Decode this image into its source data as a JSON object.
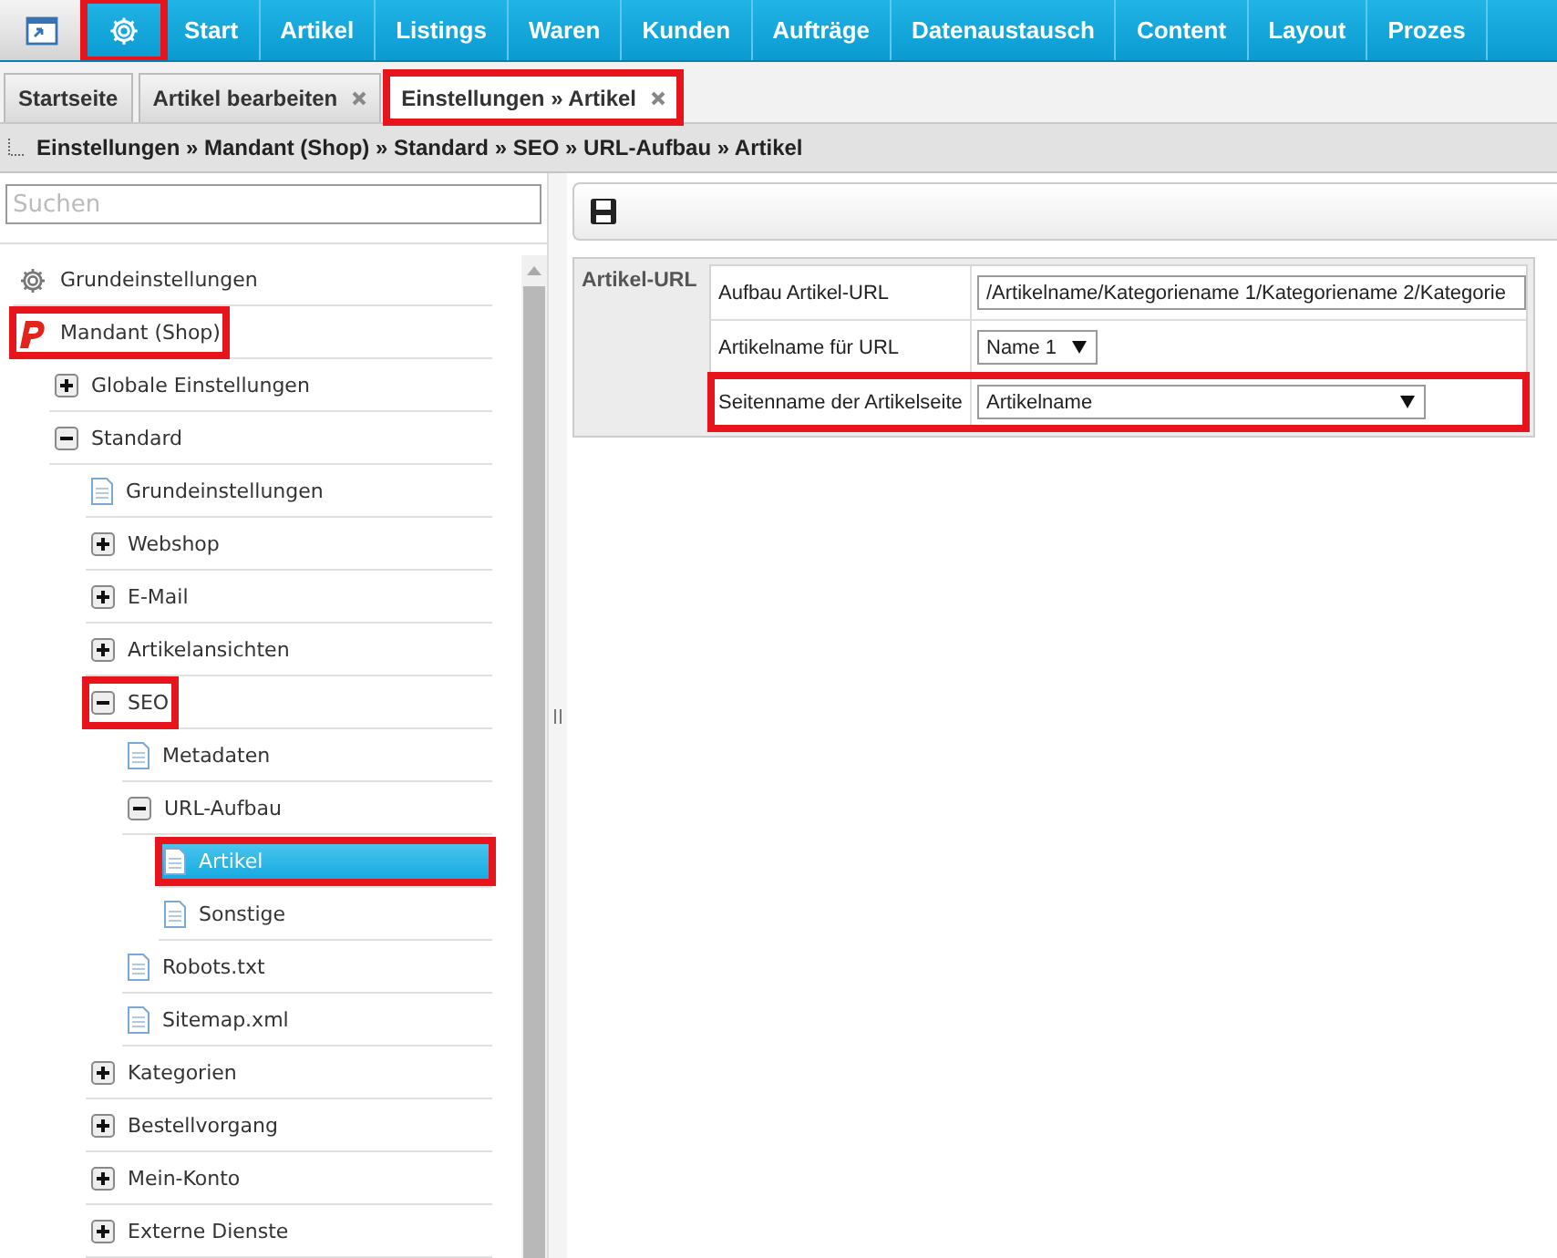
{
  "nav": {
    "icons": [
      {
        "kind": "app",
        "highlighted": false
      },
      {
        "kind": "gear",
        "highlighted": true
      }
    ],
    "items": [
      "Start",
      "Artikel",
      "Listings",
      "Waren",
      "Kunden",
      "Aufträge",
      "Datenaustausch",
      "Content",
      "Layout",
      "Prozes"
    ]
  },
  "tabs": [
    {
      "label": "Startseite",
      "closable": false,
      "selected": false,
      "highlighted": false
    },
    {
      "label": "Artikel bearbeiten",
      "closable": true,
      "selected": false,
      "highlighted": false
    },
    {
      "label": "Einstellungen » Artikel",
      "closable": true,
      "selected": true,
      "highlighted": true
    }
  ],
  "breadcrumb": "Einstellungen » Mandant (Shop) » Standard » SEO » URL-Aufbau » Artikel",
  "search": {
    "placeholder": "Suchen"
  },
  "tree": [
    {
      "label": "Grundeinstellungen",
      "kind": "gear",
      "selected": false,
      "highlighted": false
    },
    {
      "label": "Mandant (Shop)",
      "kind": "brand",
      "selected": false,
      "highlighted": true,
      "children": [
        {
          "label": "Globale Einstellungen",
          "kind": "folder",
          "expanded": false,
          "selected": false,
          "highlighted": false
        },
        {
          "label": "Standard",
          "kind": "folder",
          "expanded": true,
          "selected": false,
          "highlighted": false,
          "children": [
            {
              "label": "Grundeinstellungen",
              "kind": "page",
              "selected": false,
              "highlighted": false
            },
            {
              "label": "Webshop",
              "kind": "folder",
              "expanded": false,
              "selected": false,
              "highlighted": false
            },
            {
              "label": "E-Mail",
              "kind": "folder",
              "expanded": false,
              "selected": false,
              "highlighted": false
            },
            {
              "label": "Artikelansichten",
              "kind": "folder",
              "expanded": false,
              "selected": false,
              "highlighted": false
            },
            {
              "label": "SEO",
              "kind": "folder",
              "expanded": true,
              "selected": false,
              "highlighted": true,
              "children": [
                {
                  "label": "Metadaten",
                  "kind": "page",
                  "selected": false,
                  "highlighted": false
                },
                {
                  "label": "URL-Aufbau",
                  "kind": "folder",
                  "expanded": true,
                  "selected": false,
                  "highlighted": false,
                  "children": [
                    {
                      "label": "Artikel",
                      "kind": "page",
                      "selected": true,
                      "highlighted": true
                    },
                    {
                      "label": "Sonstige",
                      "kind": "page",
                      "selected": false,
                      "highlighted": false
                    }
                  ]
                },
                {
                  "label": "Robots.txt",
                  "kind": "page",
                  "selected": false,
                  "highlighted": false
                },
                {
                  "label": "Sitemap.xml",
                  "kind": "page",
                  "selected": false,
                  "highlighted": false
                }
              ]
            },
            {
              "label": "Kategorien",
              "kind": "folder",
              "expanded": false,
              "selected": false,
              "highlighted": false
            },
            {
              "label": "Bestellvorgang",
              "kind": "folder",
              "expanded": false,
              "selected": false,
              "highlighted": false
            },
            {
              "label": "Mein-Konto",
              "kind": "folder",
              "expanded": false,
              "selected": false,
              "highlighted": false
            },
            {
              "label": "Externe Dienste",
              "kind": "folder",
              "expanded": false,
              "selected": false,
              "highlighted": false
            }
          ]
        }
      ]
    }
  ],
  "form": {
    "group": "Artikel-URL",
    "rows": [
      {
        "label": "Aufbau Artikel-URL",
        "value": "/Artikelname/Kategoriename 1/Kategoriename 2/Kategorie",
        "highlighted": false
      },
      {
        "label": "Artikelname für URL",
        "value": "Name 1",
        "highlighted": false
      },
      {
        "label": "Seitenname der Artikelseite",
        "value": "Artikelname",
        "highlighted": true
      }
    ]
  }
}
